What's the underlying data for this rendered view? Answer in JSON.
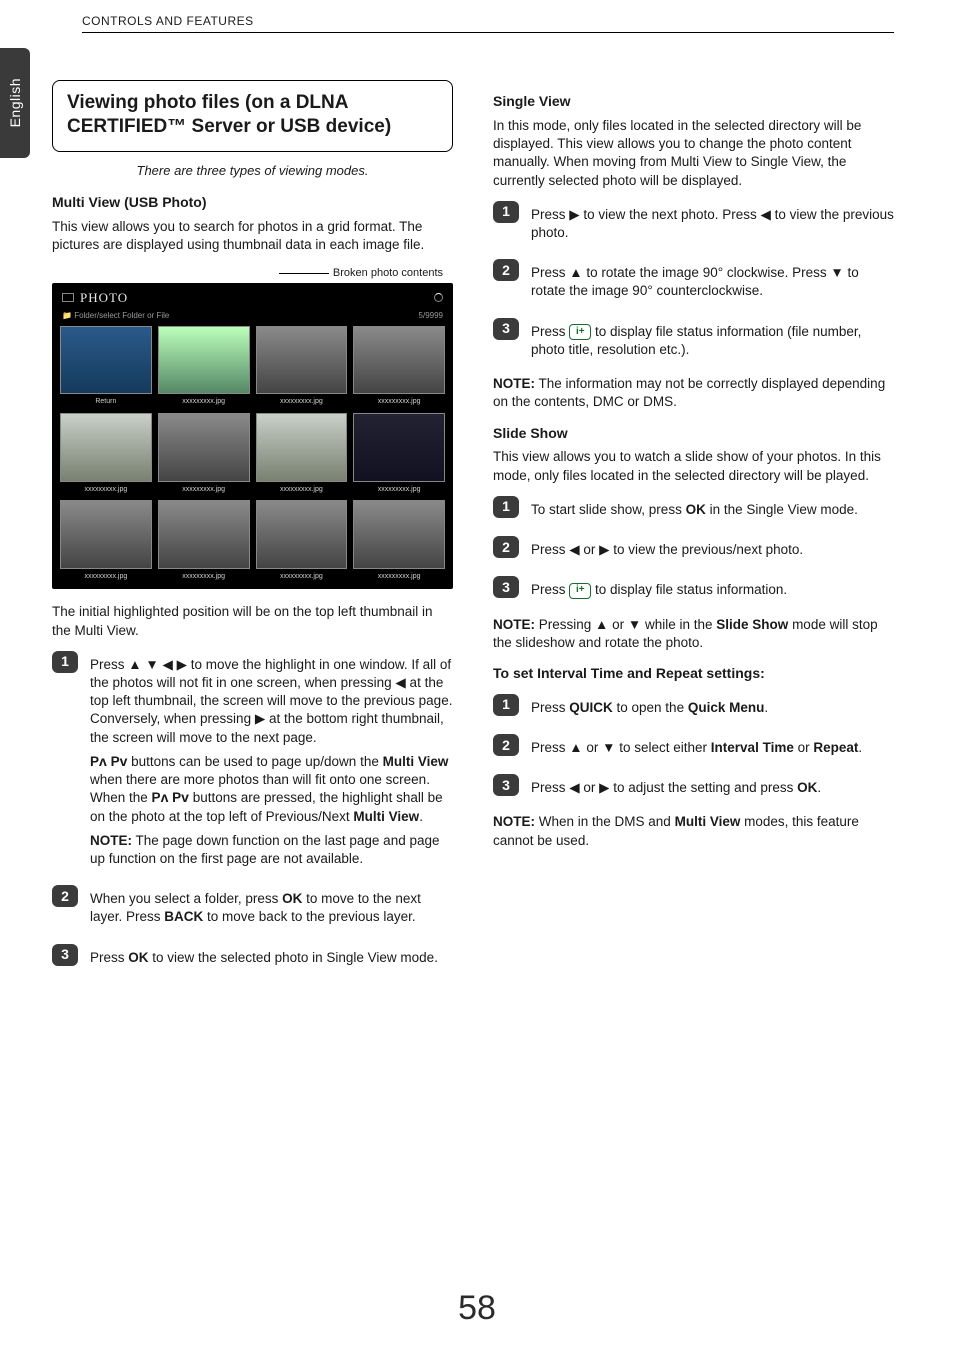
{
  "header": {
    "breadcrumb": "CONTROLS AND FEATURES"
  },
  "sidetab": {
    "label": "English"
  },
  "pageNumber": "58",
  "left": {
    "titlebox": "Viewing photo files (on a DLNA CERTIFIED™ Server or USB device)",
    "subtitle": "There are three types of viewing modes.",
    "h_multiview": "Multi View (USB Photo)",
    "p_multiview_intro": "This view allows you to search for photos in a grid format. The pictures are displayed using thumbnail data in each image file.",
    "screenshot": {
      "label": "Broken photo contents",
      "brand": "PHOTO",
      "folderlabel": "Folder/select Folder or File",
      "count": "5/9999",
      "returnLabel": "Return",
      "tilecap": "xxxxxxxxx.jpg"
    },
    "p_initial": "The initial highlighted position will be on the top left thumbnail in the Multi View.",
    "steps": {
      "s1a": "Press ▲ ▼ ◀ ▶ to move the highlight in one window. If all of the photos will not fit in one screen, when pressing ◀ at the top left thumbnail, the screen will move to the previous page. Conversely, when pressing ▶ at the bottom right thumbnail, the screen will move to the next page.",
      "s1b_pre": "P",
      "s1b": " buttons can be used to page up/down the ",
      "s1b_bold": "Multi View",
      "s1b_after": " when there are more photos than will fit onto one screen. When the ",
      "s1b_after2": " buttons are pressed, the highlight shall be on the photo at the top left of Previous/Next ",
      "s1b_bold2": "Multi View",
      "s1b_period": ".",
      "note1_label": "NOTE:",
      "note1": " The page down function on the last page and page up function on the first page are not available.",
      "s2a": "When you select a folder, press ",
      "s2a_ok": "OK",
      "s2a_mid": " to move to the next layer. Press ",
      "s2a_back": "BACK",
      "s2a_end": " to move back to the previous layer.",
      "s3a": "Press ",
      "s3a_ok": "OK",
      "s3a_end": " to view the selected photo in Single View mode."
    }
  },
  "right": {
    "h_single": "Single View",
    "p_single": "In this mode, only files located in the selected directory will be displayed. This view allows you to change the photo content manually. When moving from Multi View to Single View, the currently selected photo will be displayed.",
    "s1": "Press ▶ to view the next photo. Press ◀ to view the previous photo.",
    "s2": "Press ▲ to rotate the image 90° clockwise. Press ▼ to rotate the image 90° counterclockwise.",
    "s3_pre": "Press ",
    "s3_post": " to display file status information (file number, photo title, resolution etc.).",
    "note_single_label": "NOTE:",
    "note_single": " The information may not be correctly displayed depending on the contents, DMC or DMS.",
    "h_slide": "Slide Show",
    "p_slide": "This view allows you to watch a slide show of your photos. In this mode, only files located in the selected directory will be played.",
    "slide_s1_pre": "To start slide show, press ",
    "slide_s1_ok": "OK",
    "slide_s1_post": " in the Single View mode.",
    "slide_s2": "Press ◀ or ▶ to view the previous/next photo.",
    "slide_s3_pre": "Press ",
    "slide_s3_post": " to display file status information.",
    "note_slide_label": "NOTE:",
    "note_slide_pre": " Pressing ▲ or ▼ while in the ",
    "note_slide_bold": "Slide Show",
    "note_slide_post": " mode will stop the slideshow and rotate the photo.",
    "h_interval": "To set Interval Time and Repeat settings:",
    "int_s1_pre": "Press ",
    "int_s1_quick": "QUICK",
    "int_s1_mid": " to open the ",
    "int_s1_qm": "Quick Menu",
    "int_s1_end": ".",
    "int_s2_pre": "Press ▲ or ▼ to select either ",
    "int_s2_it": "Interval Time",
    "int_s2_or": " or ",
    "int_s2_rep": "Repeat",
    "int_s2_end": ".",
    "int_s3_pre": "Press ◀ or ▶ to adjust the setting and press ",
    "int_s3_ok": "OK",
    "int_s3_end": ".",
    "note_int_label": "NOTE:",
    "note_int_pre": " When in the DMS and ",
    "note_int_bold": "Multi View",
    "note_int_post": " modes, this feature cannot be used."
  },
  "icons": {
    "info": "i+"
  }
}
